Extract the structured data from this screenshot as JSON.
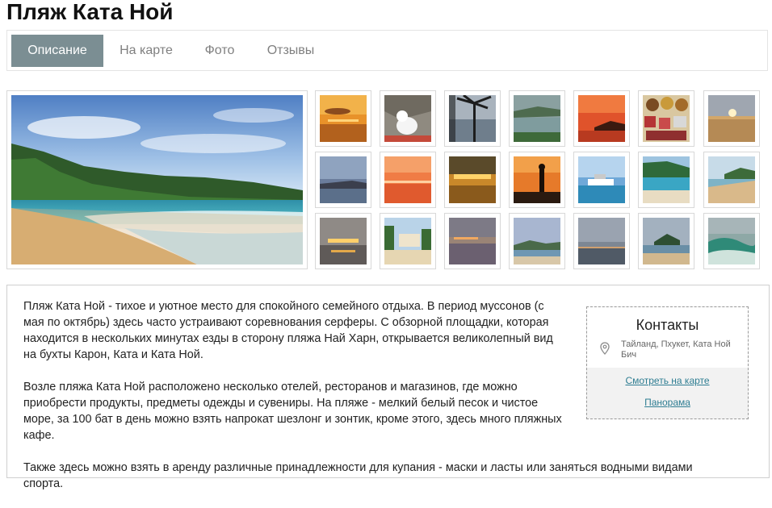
{
  "page": {
    "title": "Пляж Ката Ной"
  },
  "tabs": [
    {
      "label": "Описание",
      "active": true
    },
    {
      "label": "На карте",
      "active": false
    },
    {
      "label": "Фото",
      "active": false
    },
    {
      "label": "Отзывы",
      "active": false
    }
  ],
  "description": [
    "Пляж Ката Ной - тихое и уютное место для спокойного семейного отдыха. В период муссонов (с мая по октябрь) здесь часто устраивают соревнования серферы. С обзорной площадки, которая находится в нескольких минутах езды в сторону пляжа Най Харн, открывается великолепный вид на бухты Карон, Ката и Ката Ной.",
    "Возле пляжа Ката Ной расположено несколько отелей, ресторанов и магазинов, где можно приобрести продукты, предметы одежды и сувениры. На пляже - мелкий белый песок и чистое море, за 100 бат в день можно взять напрокат шезлонг и зонтик, кроме этого, здесь много пляжных кафе.",
    "Также здесь можно взять в аренду различные принадлежности для купания - маски и ласты или заняться водными видами спорта."
  ],
  "contacts": {
    "title": "Контакты",
    "address": "Тайланд, Пхукет, Ката Ной Бич",
    "map_link": "Смотреть на карте",
    "panorama_link": "Панорама"
  },
  "theme": {
    "active_tab": "#7b8e93",
    "link": "#2e7d92"
  }
}
